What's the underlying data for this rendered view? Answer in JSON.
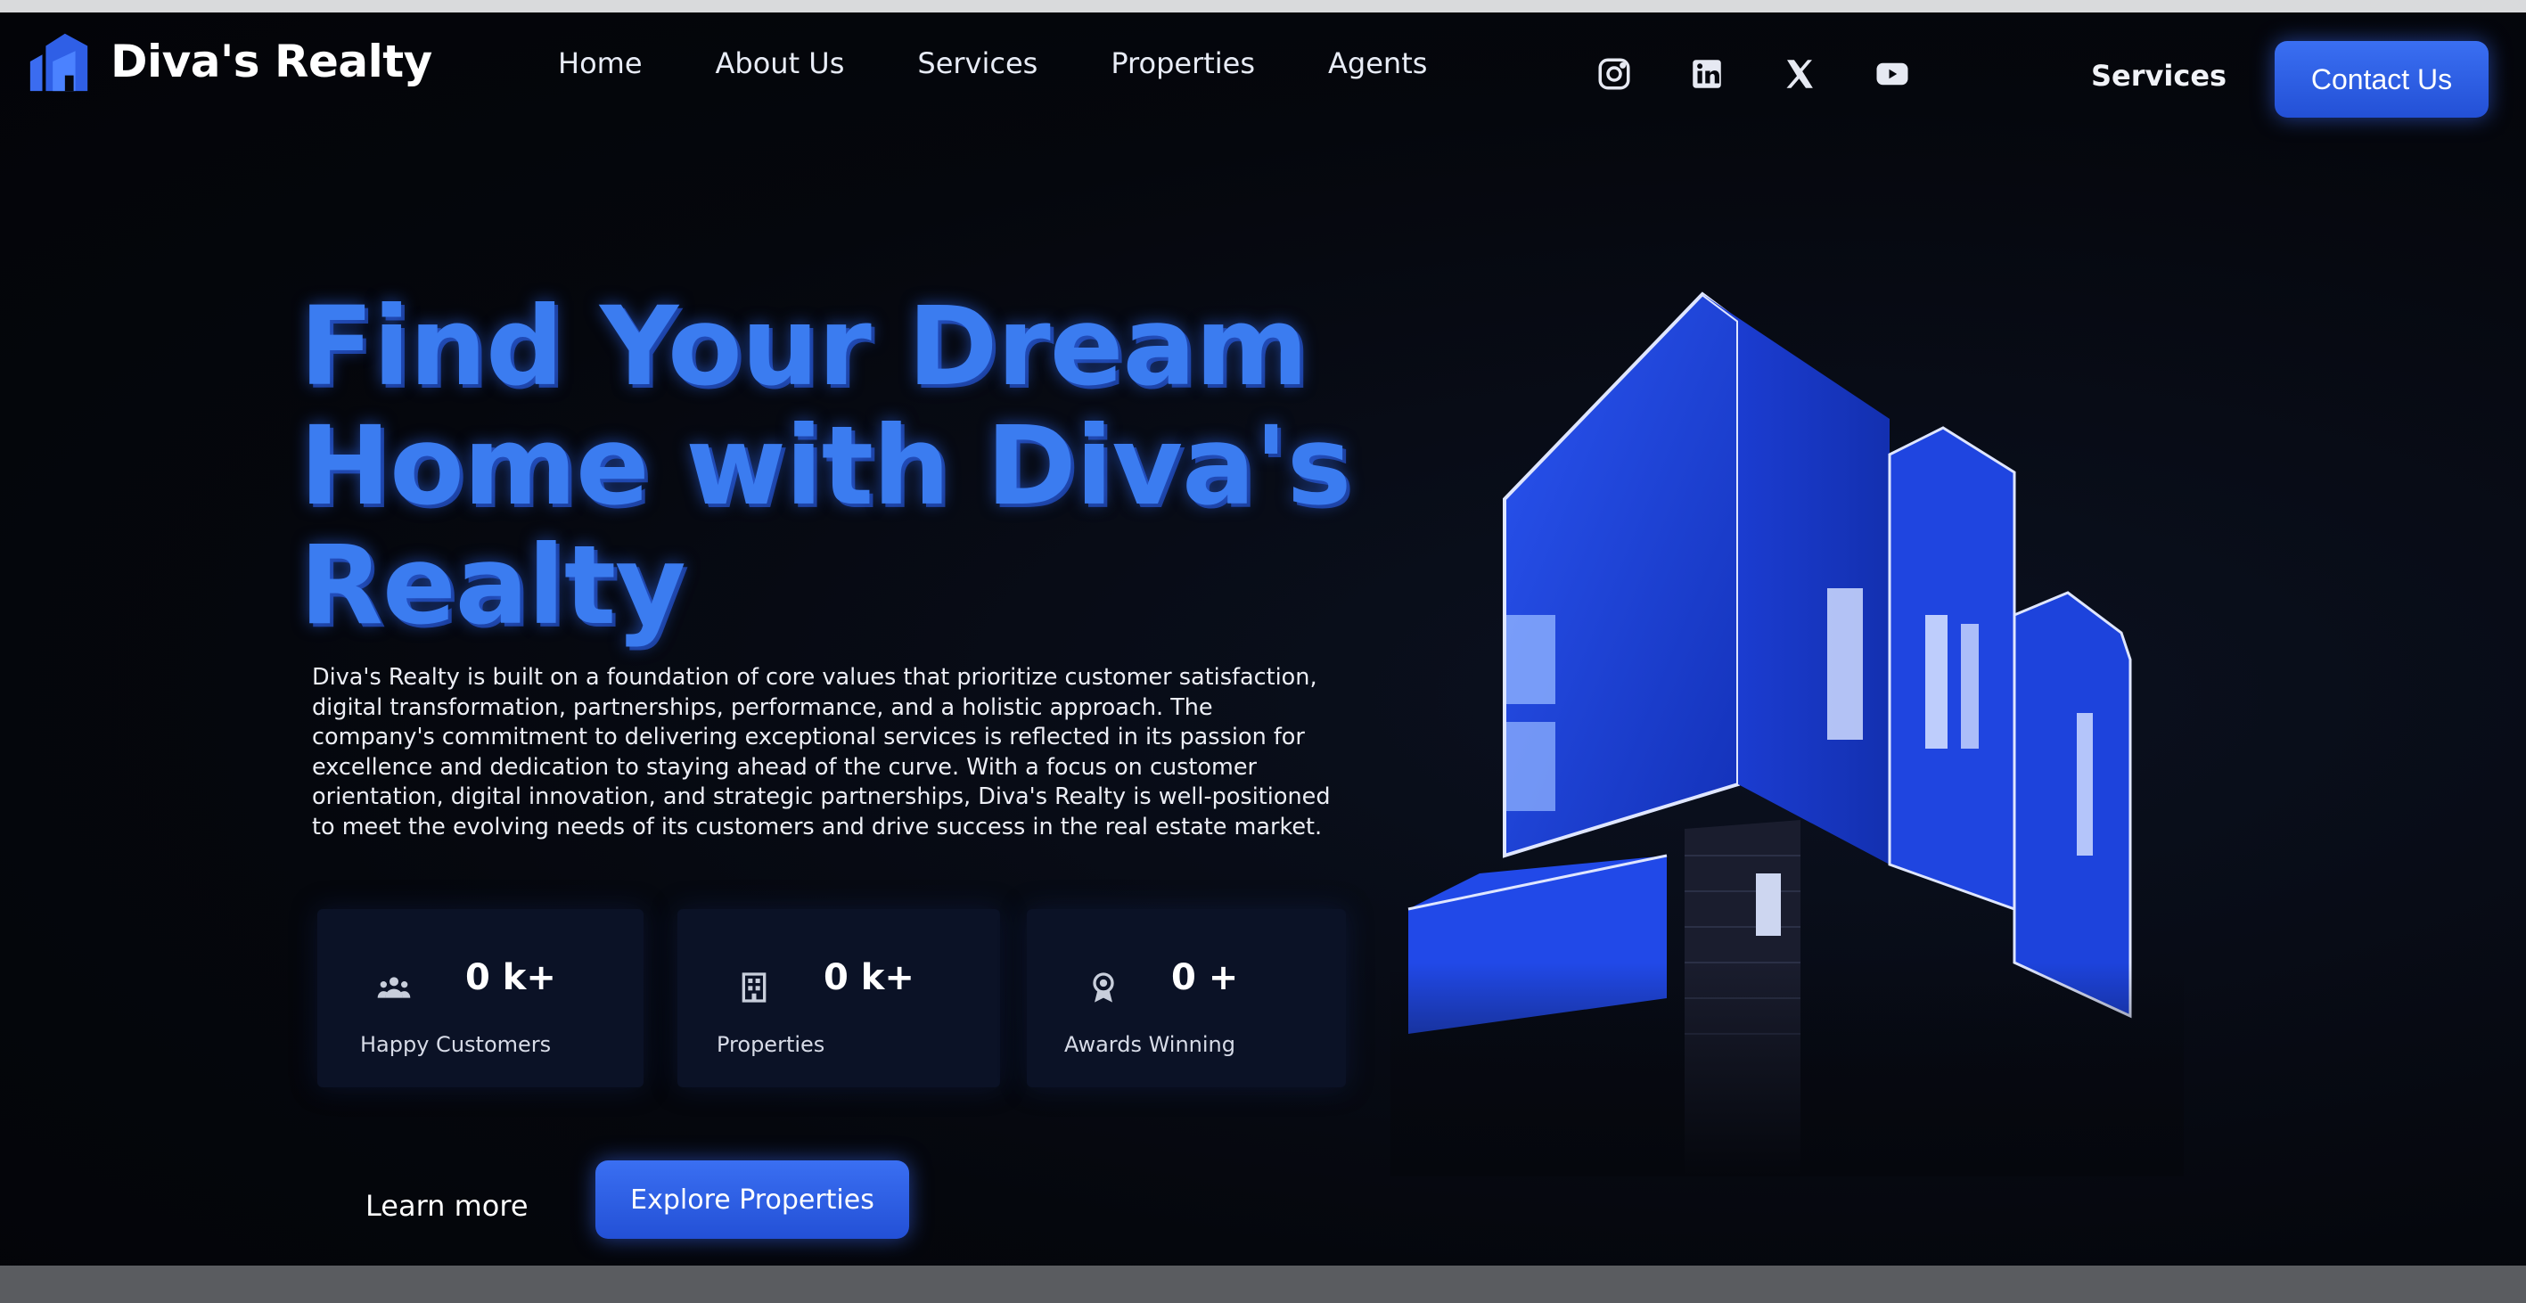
{
  "brand": {
    "name": "Diva's Realty"
  },
  "nav": {
    "items": [
      "Home",
      "About Us",
      "Services",
      "Properties",
      "Agents"
    ],
    "services_label": "Services",
    "contact_label": "Contact Us"
  },
  "socials": [
    "instagram-icon",
    "linkedin-icon",
    "x-icon",
    "youtube-icon"
  ],
  "hero": {
    "title_lines": [
      "Find Your Dream",
      "Home with Diva's",
      "Realty"
    ],
    "description": "Diva's Realty is built on a foundation of core values that prioritize customer satisfaction, digital transformation, partnerships, performance, and a holistic approach. The company's commitment to delivering exceptional services is reflected in its passion for excellence and dedication to staying ahead of the curve. With a focus on customer orientation, digital innovation, and strategic partnerships, Diva's Realty is well-positioned to meet the evolving needs of its customers and drive success in the real estate market."
  },
  "stats": [
    {
      "icon": "people-icon",
      "value": "0 k+",
      "label": "Happy Customers"
    },
    {
      "icon": "building-icon",
      "value": "0 k+",
      "label": "Properties"
    },
    {
      "icon": "award-icon",
      "value": "0 +",
      "label": "Awards Winning"
    }
  ],
  "actions": {
    "learn_more": "Learn more",
    "explore": "Explore Properties"
  },
  "colors": {
    "accent": "#3b7cf0",
    "button": "#2f5fe6",
    "background": "#05070d",
    "card": "#0b1226"
  }
}
